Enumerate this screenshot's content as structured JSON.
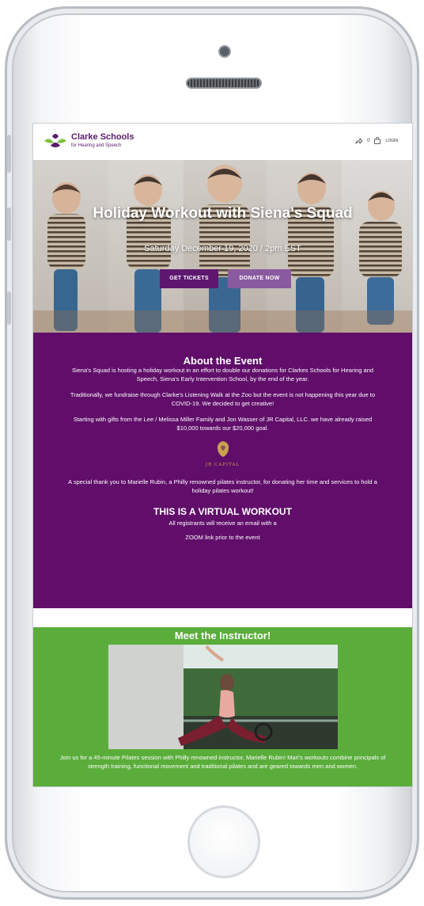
{
  "header": {
    "brand_name": "Clarke Schools",
    "brand_sub": "for Hearing and Speech",
    "cart_count": "0",
    "login_label": "LOGIN",
    "icons": [
      "logo-leaf-icon",
      "share-icon",
      "shopping-bag-icon"
    ]
  },
  "hero": {
    "title": "Holiday Workout with Siena's Squad",
    "date": "Saturday December 19, 2020 / 2pm EST",
    "tickets_label": "GET TICKETS",
    "donate_label": "DONATE NOW"
  },
  "about": {
    "heading": "About the Event",
    "p1": "Siena's Squad is hosting a holiday workout in an effort to double our donations for Clarkes Schools for Hearing and Speech, Siena's Early Intervention School, by the end of the year.",
    "p2": "Traditionally, we fundraise through Clarke's Listening Walk at the Zoo but the event is not happening this year due to COVID-19. We decided to get creative!",
    "p3": "Starting with gifts from the Lee / Melissa Miller Family and Jon Wasser of JR Capital, LLC. we have already raised $10,000 towards our $20,000 goal.",
    "sponsor_logo_text": "JR CAPITAL",
    "p4": "A special thank you to Marielle Rubin, a Philly renowned pilates instructor, for donating her time and services to hold a holiday pilates workout!",
    "virtual_heading": "THIS IS A VIRTUAL WORKOUT",
    "virtual_line1": "All registrants will receive an email with a",
    "virtual_line2": "ZOOM link prior to the event"
  },
  "instructor": {
    "heading": "Meet the Instructor!",
    "description": "Join us for a 45-minute Pilates session with Philly renowned instructor, Marielle Rubin! Mari's workouts combine principals of strength training, functional movement and traditional pilates and are geared towards men and women."
  },
  "colors": {
    "purple": "#600e6a",
    "green": "#5aad3a",
    "button_dark": "#5d176f",
    "button_light": "#8a5aa0"
  }
}
